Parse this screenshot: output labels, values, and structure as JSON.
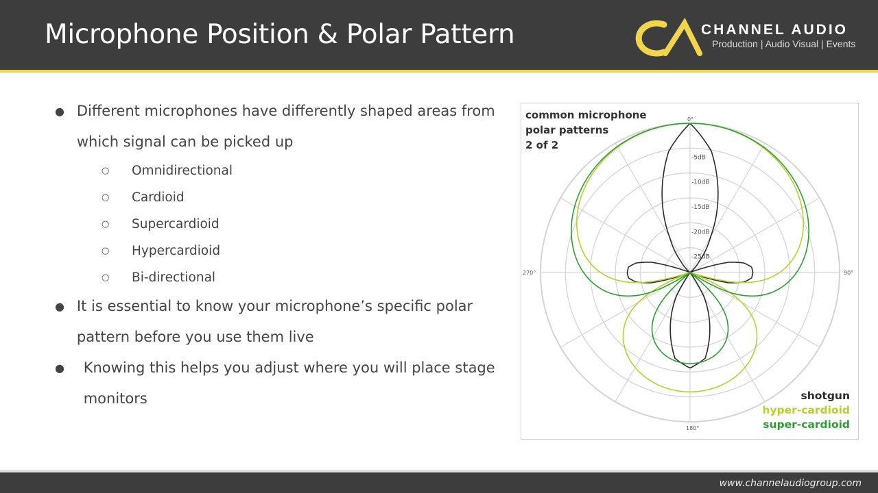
{
  "header": {
    "title": "Microphone Position & Polar Pattern",
    "logo_text": "CA",
    "brand": "CHANNEL AUDIO",
    "tagline": "Production | Audio Visual | Events",
    "accent": "#f1d54a"
  },
  "bullets": [
    {
      "text": "Different microphones have differently shaped areas from which signal can be picked up",
      "subitems": [
        "Omnidirectional",
        "Cardioid",
        "Supercardioid",
        "Hypercardioid",
        "Bi-directional"
      ]
    },
    {
      "text": "It is essential to know your microphone’s specific polar pattern before you use them live"
    },
    {
      "text": "Knowing this helps you adjust where you will place stage monitors"
    }
  ],
  "chart_data": {
    "type": "polar",
    "title_lines": [
      "common microphone",
      "polar patterns",
      "2 of 2"
    ],
    "angle_labels": [
      "0°",
      "90°",
      "180°",
      "270°"
    ],
    "ring_labels": [
      "-5dB",
      "-10dB",
      "-15dB",
      "-20dB",
      "-25dB"
    ],
    "r_range_db": [
      -30,
      0
    ],
    "grid": true,
    "legend_position": "bottom-right",
    "series": [
      {
        "name": "shotgun",
        "color": "#2a2a2a",
        "angles_deg": [
          0,
          10,
          20,
          30,
          40,
          50,
          60,
          65,
          70,
          75,
          80,
          85,
          90,
          95,
          100,
          105,
          110,
          115,
          120,
          145,
          150,
          160,
          170,
          180
        ],
        "db": [
          0,
          -5.3,
          -13.6,
          -21.8,
          -27.3,
          -30,
          -30,
          -30,
          -29,
          -22,
          -19,
          -17.6,
          -17.4,
          -17.6,
          -19,
          -22,
          -29,
          -30,
          -30,
          -30,
          -24.5,
          -18.4,
          -12.5,
          -10.8
        ]
      },
      {
        "name": "hyper-cardioid",
        "color": "#b9cf2e",
        "pattern_a": 0.25
      },
      {
        "name": "super-cardioid",
        "color": "#2e9e33",
        "pattern_a": 0.37
      }
    ]
  },
  "footer": {
    "url": "www.channelaudiogroup.com"
  }
}
